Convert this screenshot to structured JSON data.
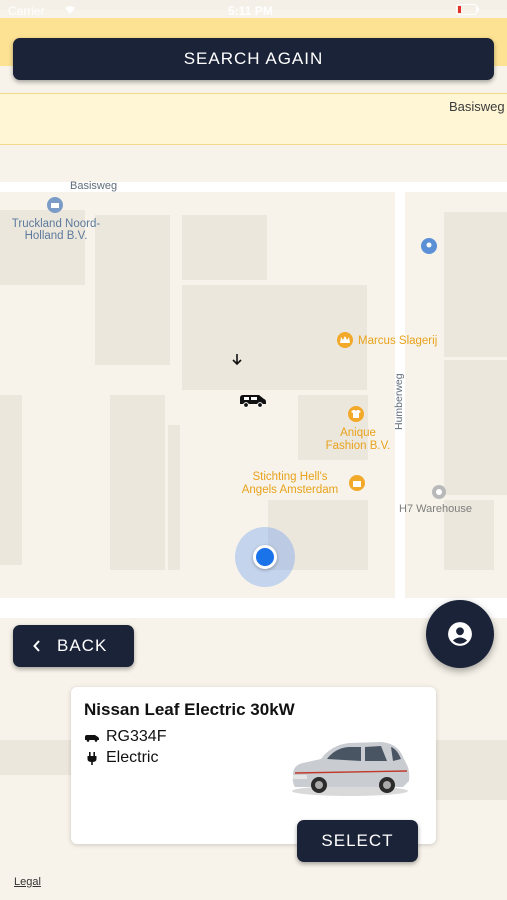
{
  "status_bar": {
    "carrier": "Carrier",
    "time": "5:11 PM"
  },
  "search": {
    "label": "SEARCH AGAIN"
  },
  "map": {
    "street_top": "Basisweg",
    "street_basisweg": "Basisweg",
    "street_humberweg": "Humberweg",
    "poi_truckland": "Truckland Noord-\nHolland B.V.",
    "poi_marcus": "Marcus Slagerij",
    "poi_anique": "Anique\nFashion B.V.",
    "poi_stichting": "Stichting Hell's\nAngels Amsterdam",
    "poi_h7": "H7 Warehouse"
  },
  "nav": {
    "back_label": "BACK"
  },
  "vehicle": {
    "name": "Nissan Leaf Electric 30kW",
    "plate": "RG334F",
    "fuel": "Electric",
    "select_label": "SELECT"
  },
  "footer": {
    "legal": "Legal"
  },
  "colors": {
    "accent_dark": "#1b2338",
    "road_yellow": "#fde293",
    "location_blue": "#1a73e8",
    "poi_orange": "#f2a92a"
  }
}
